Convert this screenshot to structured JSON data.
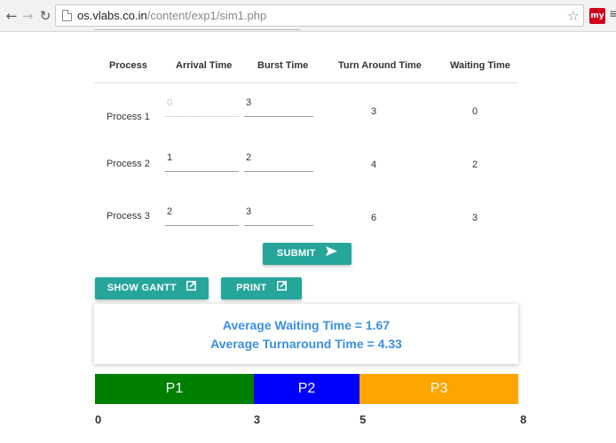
{
  "browser": {
    "url_host": "os.vlabs.co.in",
    "url_path": "/content/exp1/sim1.php",
    "extension_label": "my"
  },
  "table": {
    "headers": [
      "Process",
      "Arrival Time",
      "Burst Time",
      "Turn Around Time",
      "Waiting Time"
    ],
    "rows": [
      {
        "process": "Process 1",
        "arrival": "0",
        "burst": "3",
        "turnaround": "3",
        "waiting": "0"
      },
      {
        "process": "Process 2",
        "arrival": "1",
        "burst": "2",
        "turnaround": "4",
        "waiting": "2"
      },
      {
        "process": "Process 3",
        "arrival": "2",
        "burst": "3",
        "turnaround": "6",
        "waiting": "3"
      }
    ]
  },
  "buttons": {
    "submit": "SUBMIT",
    "show_gantt": "SHOW GANTT",
    "print": "PRINT"
  },
  "results": {
    "avg_waiting": "Average Waiting Time = 1.67",
    "avg_turnaround": "Average Turnaround Time = 4.33"
  },
  "gantt": {
    "segments": [
      {
        "label": "P1",
        "start": 0,
        "end": 3,
        "color": "#008000"
      },
      {
        "label": "P2",
        "start": 3,
        "end": 5,
        "color": "#0000ff"
      },
      {
        "label": "P3",
        "start": 5,
        "end": 8,
        "color": "#ffa500"
      }
    ],
    "ticks": [
      "0",
      "3",
      "5",
      "8"
    ]
  },
  "colors": {
    "accent": "#26a69a",
    "result_text": "#3a8fe0"
  }
}
